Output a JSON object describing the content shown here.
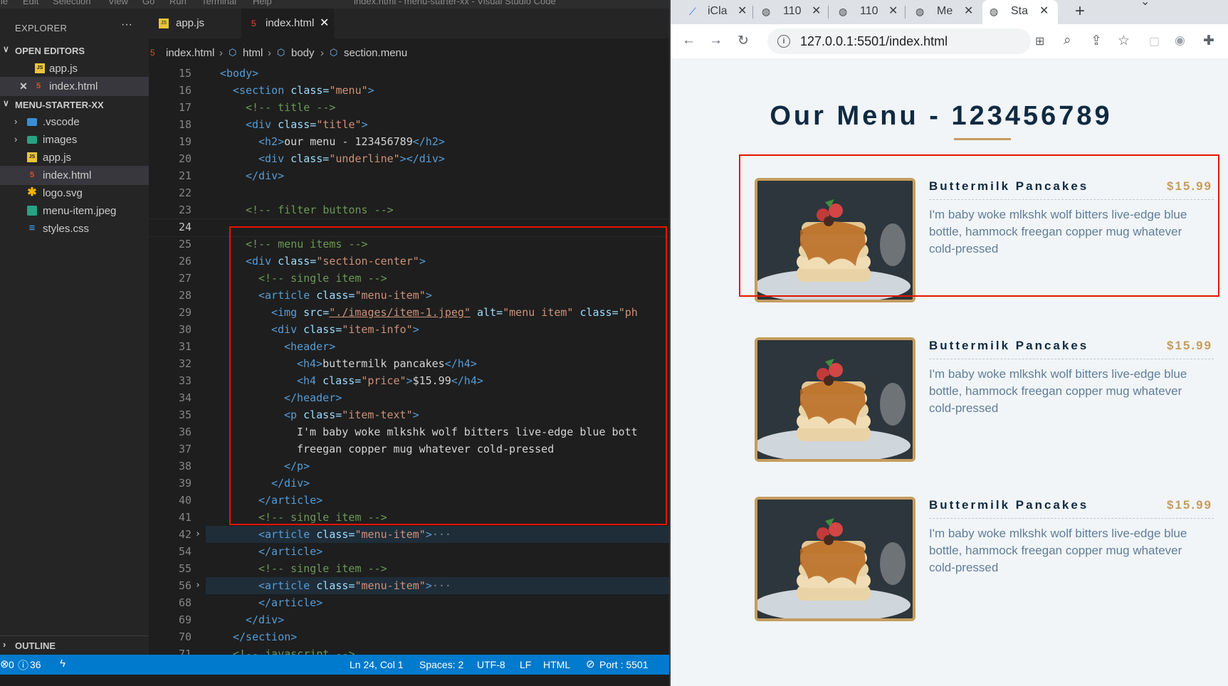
{
  "menubar": [
    "ile",
    "Edit",
    "Selection",
    "View",
    "Go",
    "Run",
    "Terminal",
    "Help"
  ],
  "window_title": "index.html - menu-starter-xx - Visual Studio Code",
  "sidebar": {
    "title": "EXPLORER",
    "more": "···",
    "open_editors_label": "OPEN EDITORS",
    "open_editors": [
      {
        "name": "app.js",
        "icon": "js-file-icon"
      },
      {
        "name": "index.html",
        "icon": "html-file-icon"
      }
    ],
    "project_label": "MENU-STARTER-XX",
    "files": [
      {
        "name": ".vscode",
        "icon": "folder-icon"
      },
      {
        "name": "images",
        "icon": "folder-icon"
      },
      {
        "name": "app.js",
        "icon": "js-file-icon"
      },
      {
        "name": "index.html",
        "icon": "html-file-icon"
      },
      {
        "name": "logo.svg",
        "icon": "svg-file-icon"
      },
      {
        "name": "menu-item.jpeg",
        "icon": "image-file-icon"
      },
      {
        "name": "styles.css",
        "icon": "css-file-icon"
      }
    ],
    "outline_label": "OUTLINE"
  },
  "tabs": [
    {
      "label": "app.js"
    },
    {
      "label": "index.html"
    }
  ],
  "breadcrumb": [
    "index.html",
    "html",
    "body",
    "section.menu"
  ],
  "line_numbers": [
    "15",
    "16",
    "17",
    "18",
    "19",
    "20",
    "21",
    "22",
    "23",
    "24",
    "25",
    "26",
    "27",
    "28",
    "29",
    "30",
    "31",
    "32",
    "33",
    "34",
    "35",
    "36",
    "37",
    "38",
    "39",
    "40",
    "41",
    "42",
    "54",
    "55",
    "56",
    "68",
    "69",
    "70",
    "71"
  ],
  "code": {
    "l15_tag": "<body>",
    "l16_a": "<section",
    "l16_b": " class=",
    "l16_c": "\"menu\"",
    "l16_d": ">",
    "l17": "<!-- title -->",
    "l18_a": "<div",
    "l18_b": " class=",
    "l18_c": "\"title\"",
    "l18_d": ">",
    "l19_a": "<h2>",
    "l19_b": "our menu - 123456789",
    "l19_c": "</h2>",
    "l20_a": "<div",
    "l20_b": " class=",
    "l20_c": "\"underline\"",
    "l20_d": "></div>",
    "l21": "</div>",
    "l23": "<!-- filter buttons -->",
    "l25": "<!-- menu items -->",
    "l26_a": "<div",
    "l26_b": " class=",
    "l26_c": "\"section-center\"",
    "l26_d": ">",
    "l27": "<!-- single item -->",
    "l28_a": "<article",
    "l28_b": " class=",
    "l28_c": "\"menu-item\"",
    "l28_d": ">",
    "l29_a": "<img",
    "l29_b": " src=",
    "l29_c": "\"./images/item-1.jpeg\"",
    "l29_d": " alt=",
    "l29_e": "\"menu item\"",
    "l29_f": " class=",
    "l29_g": "\"ph",
    "l30_a": "<div",
    "l30_b": " class=",
    "l30_c": "\"item-info\"",
    "l30_d": ">",
    "l31": "<header>",
    "l32_a": "<h4>",
    "l32_b": "buttermilk pancakes",
    "l32_c": "</h4>",
    "l33_a": "<h4",
    "l33_b": " class=",
    "l33_c": "\"price\"",
    "l33_d": ">",
    "l33_e": "$15.99",
    "l33_f": "</h4>",
    "l34": "</header>",
    "l35_a": "<p",
    "l35_b": " class=",
    "l35_c": "\"item-text\"",
    "l35_d": ">",
    "l36": "I'm baby woke mlkshk wolf bitters live-edge blue bott",
    "l37": "freegan copper mug whatever cold-pressed",
    "l38": "</p>",
    "l39": "</div>",
    "l40": "</article>",
    "l41": "<!-- single item -->",
    "l42_a": "<article",
    "l42_b": " class=",
    "l42_c": "\"menu-item\"",
    "l42_d": ">",
    "l42_e": "···",
    "l54": "</article>",
    "l55": "<!-- single item -->",
    "l56_a": "<article",
    "l56_b": " class=",
    "l56_c": "\"menu-item\"",
    "l56_d": ">",
    "l56_e": "···",
    "l68": "</article>",
    "l69": "</div>",
    "l70": "</section>",
    "l71": "<!-- javascript -->"
  },
  "status": {
    "errors": "0",
    "warnings": "36",
    "position": "Ln 24, Col 1",
    "spaces": "Spaces: 2",
    "encoding": "UTF-8",
    "eol": "LF",
    "language": "HTML",
    "port": "Port : 5501"
  },
  "browser": {
    "tabs": [
      {
        "label": "iCla",
        "icon": "icla-favicon"
      },
      {
        "label": "110",
        "icon": "globe-icon"
      },
      {
        "label": "110",
        "icon": "globe-icon"
      },
      {
        "label": "Me",
        "icon": "globe-icon"
      },
      {
        "label": "Sta",
        "icon": "globe-icon"
      }
    ],
    "url": "127.0.0.1:5501/index.html"
  },
  "page": {
    "title": "Our Menu - 123456789",
    "items": [
      {
        "name": "Buttermilk Pancakes",
        "price": "$15.99",
        "desc": "I'm baby woke mlkshk wolf bitters live-edge blue bottle, hammock freegan copper mug whatever cold-pressed"
      },
      {
        "name": "Buttermilk Pancakes",
        "price": "$15.99",
        "desc": "I'm baby woke mlkshk wolf bitters live-edge blue bottle, hammock freegan copper mug whatever cold-pressed"
      },
      {
        "name": "Buttermilk Pancakes",
        "price": "$15.99",
        "desc": "I'm baby woke mlkshk wolf bitters live-edge blue bottle, hammock freegan copper mug whatever cold-pressed"
      }
    ]
  },
  "colors": {
    "accent_gold": "#c59d5f",
    "status_blue": "#007acc",
    "highlight_red": "#e51400"
  }
}
